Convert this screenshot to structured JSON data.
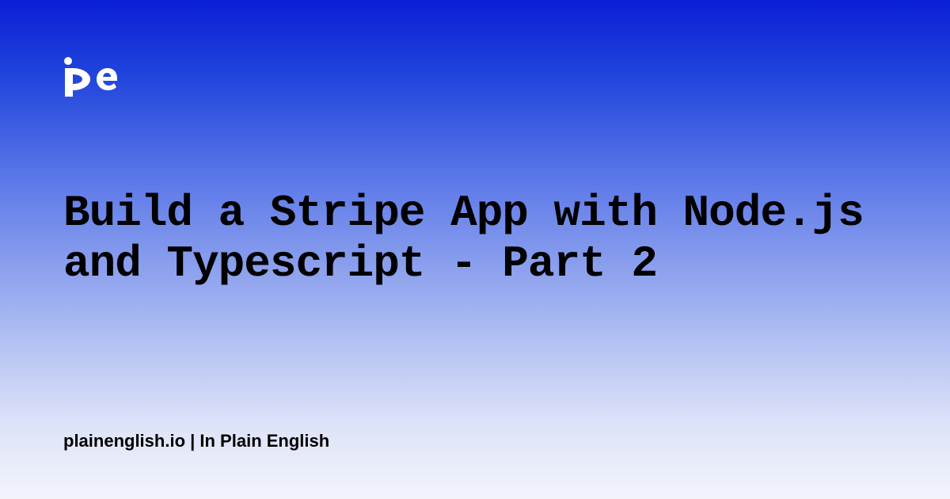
{
  "logo": {
    "name": "pe-logo"
  },
  "title": "Build a Stripe App with Node.js and Typescript - Part 2",
  "footer": "plainenglish.io | In Plain English"
}
